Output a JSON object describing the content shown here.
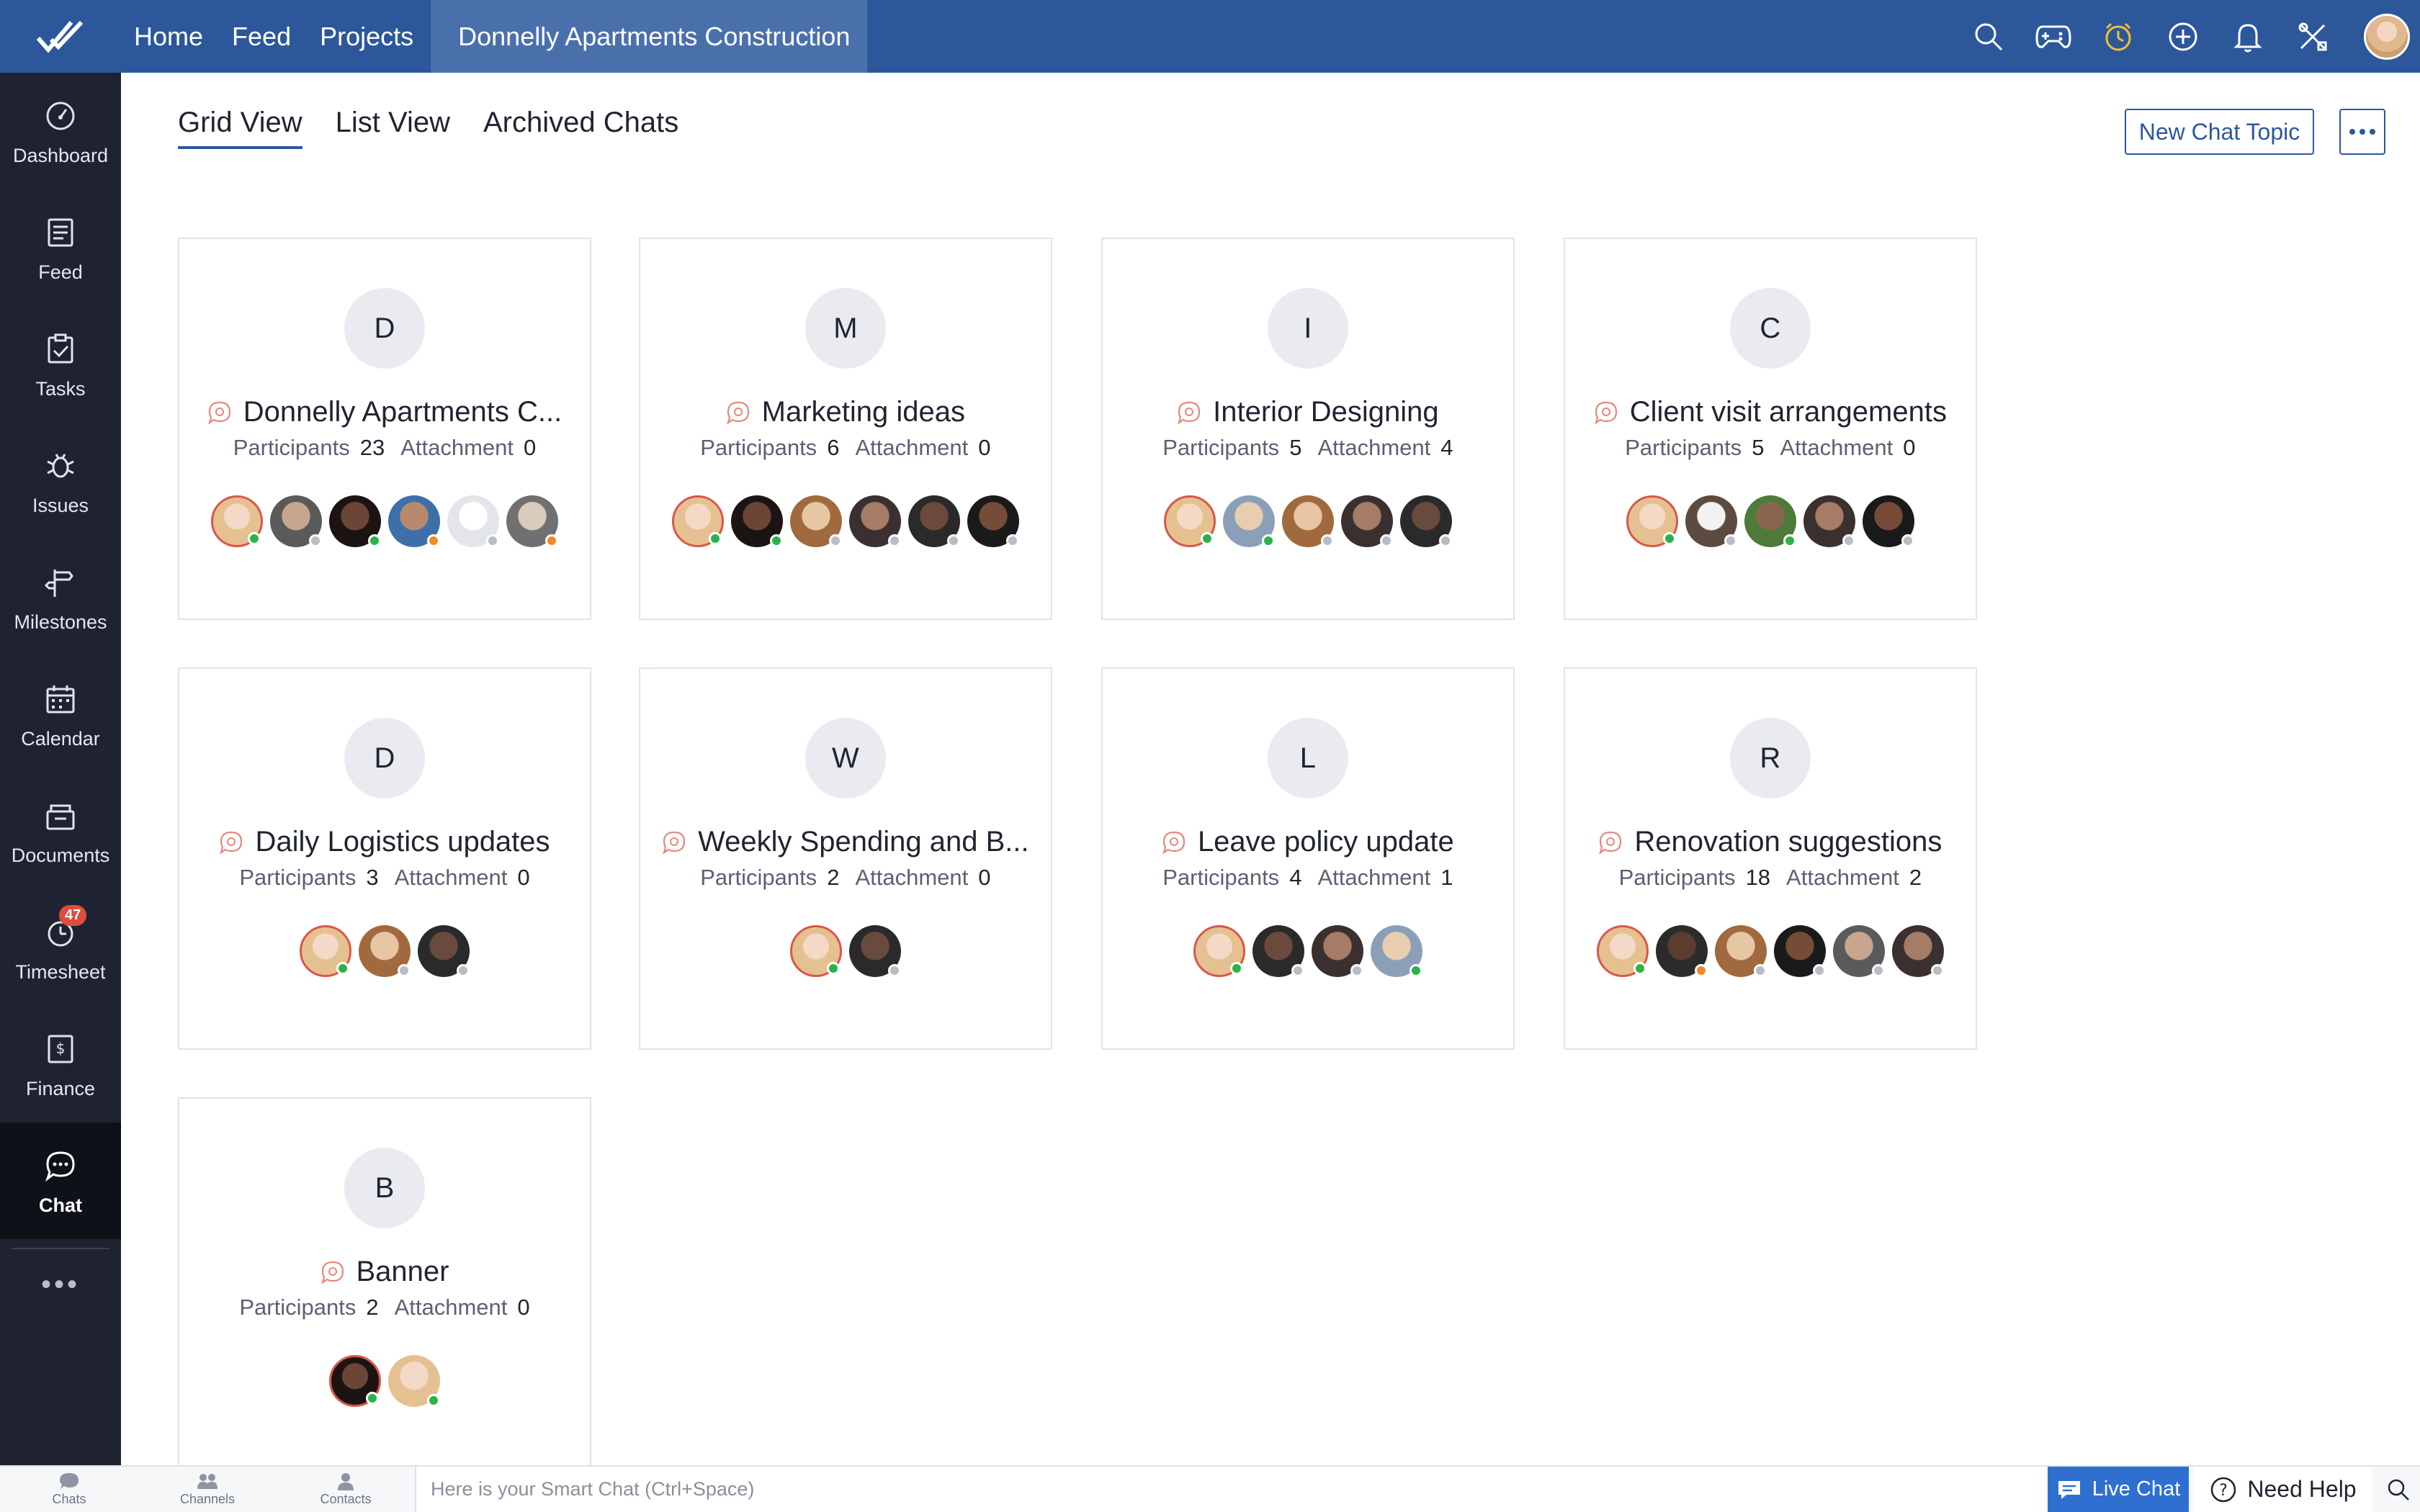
{
  "topbar": {
    "nav": [
      "Home",
      "Feed",
      "Projects"
    ],
    "project_tab": "Donnelly Apartments Construction",
    "icons": [
      "search-icon",
      "gamepad-icon",
      "timer-icon",
      "add-icon",
      "bell-icon",
      "tools-icon"
    ]
  },
  "sidebar": {
    "items": [
      {
        "label": "Dashboard",
        "icon": "dashboard-icon"
      },
      {
        "label": "Feed",
        "icon": "feed-icon"
      },
      {
        "label": "Tasks",
        "icon": "tasks-icon"
      },
      {
        "label": "Issues",
        "icon": "bug-icon"
      },
      {
        "label": "Milestones",
        "icon": "signpost-icon"
      },
      {
        "label": "Calendar",
        "icon": "calendar-icon"
      },
      {
        "label": "Documents",
        "icon": "documents-icon"
      },
      {
        "label": "Timesheet",
        "icon": "timesheet-icon",
        "badge": "47"
      },
      {
        "label": "Finance",
        "icon": "finance-icon"
      },
      {
        "label": "Chat",
        "icon": "chat-icon",
        "active": true
      }
    ],
    "more": "•••"
  },
  "tabs": [
    "Grid View",
    "List View",
    "Archived Chats"
  ],
  "actions": {
    "new_chat": "New Chat Topic"
  },
  "labels": {
    "participants": "Participants",
    "attachment": "Attachment"
  },
  "cards": [
    {
      "letter": "D",
      "title": "Donnelly Apartments C...",
      "participants": "23",
      "attachments": "0",
      "avatars": [
        "p1:green:owner",
        "p2:grey",
        "p3:green",
        "p4:orange",
        "p0:grey",
        "p5:orange"
      ]
    },
    {
      "letter": "M",
      "title": "Marketing ideas",
      "participants": "6",
      "attachments": "0",
      "avatars": [
        "p1:green:owner",
        "p3:green",
        "p6:grey",
        "p7:grey",
        "p8:grey",
        "p9:grey"
      ]
    },
    {
      "letter": "I",
      "title": "Interior Designing",
      "participants": "5",
      "attachments": "4",
      "avatars": [
        "p1:green:owner",
        "p10:green",
        "p6:grey",
        "p7:grey",
        "p8:grey"
      ]
    },
    {
      "letter": "C",
      "title": "Client visit arrangements",
      "participants": "5",
      "attachments": "0",
      "avatars": [
        "p1:green:owner",
        "p11:grey",
        "p12:green",
        "p7:grey",
        "p9:grey"
      ]
    },
    {
      "letter": "D",
      "title": "Daily Logistics updates",
      "participants": "3",
      "attachments": "0",
      "avatars": [
        "p1:green:owner",
        "p6:grey",
        "p8:grey"
      ]
    },
    {
      "letter": "W",
      "title": "Weekly Spending and B...",
      "participants": "2",
      "attachments": "0",
      "avatars": [
        "p1:green:owner",
        "p8:grey"
      ]
    },
    {
      "letter": "L",
      "title": "Leave policy update",
      "participants": "4",
      "attachments": "1",
      "avatars": [
        "p1:green:owner",
        "p8:grey",
        "p7:grey",
        "p10:green"
      ]
    },
    {
      "letter": "R",
      "title": "Renovation suggestions",
      "participants": "18",
      "attachments": "2",
      "avatars": [
        "p1:green:owner",
        "p13:orange",
        "p6:grey",
        "p9:grey",
        "p2:grey",
        "p7:grey"
      ]
    },
    {
      "letter": "B",
      "title": "Banner",
      "participants": "2",
      "attachments": "0",
      "avatars": [
        "p3:green:owner",
        "p1:green"
      ]
    }
  ],
  "bottombar": {
    "items": [
      "Chats",
      "Channels",
      "Contacts"
    ],
    "smart_chat_placeholder": "Here is your Smart Chat (Ctrl+Space)",
    "live_chat": "Live Chat",
    "need_help": "Need Help"
  }
}
